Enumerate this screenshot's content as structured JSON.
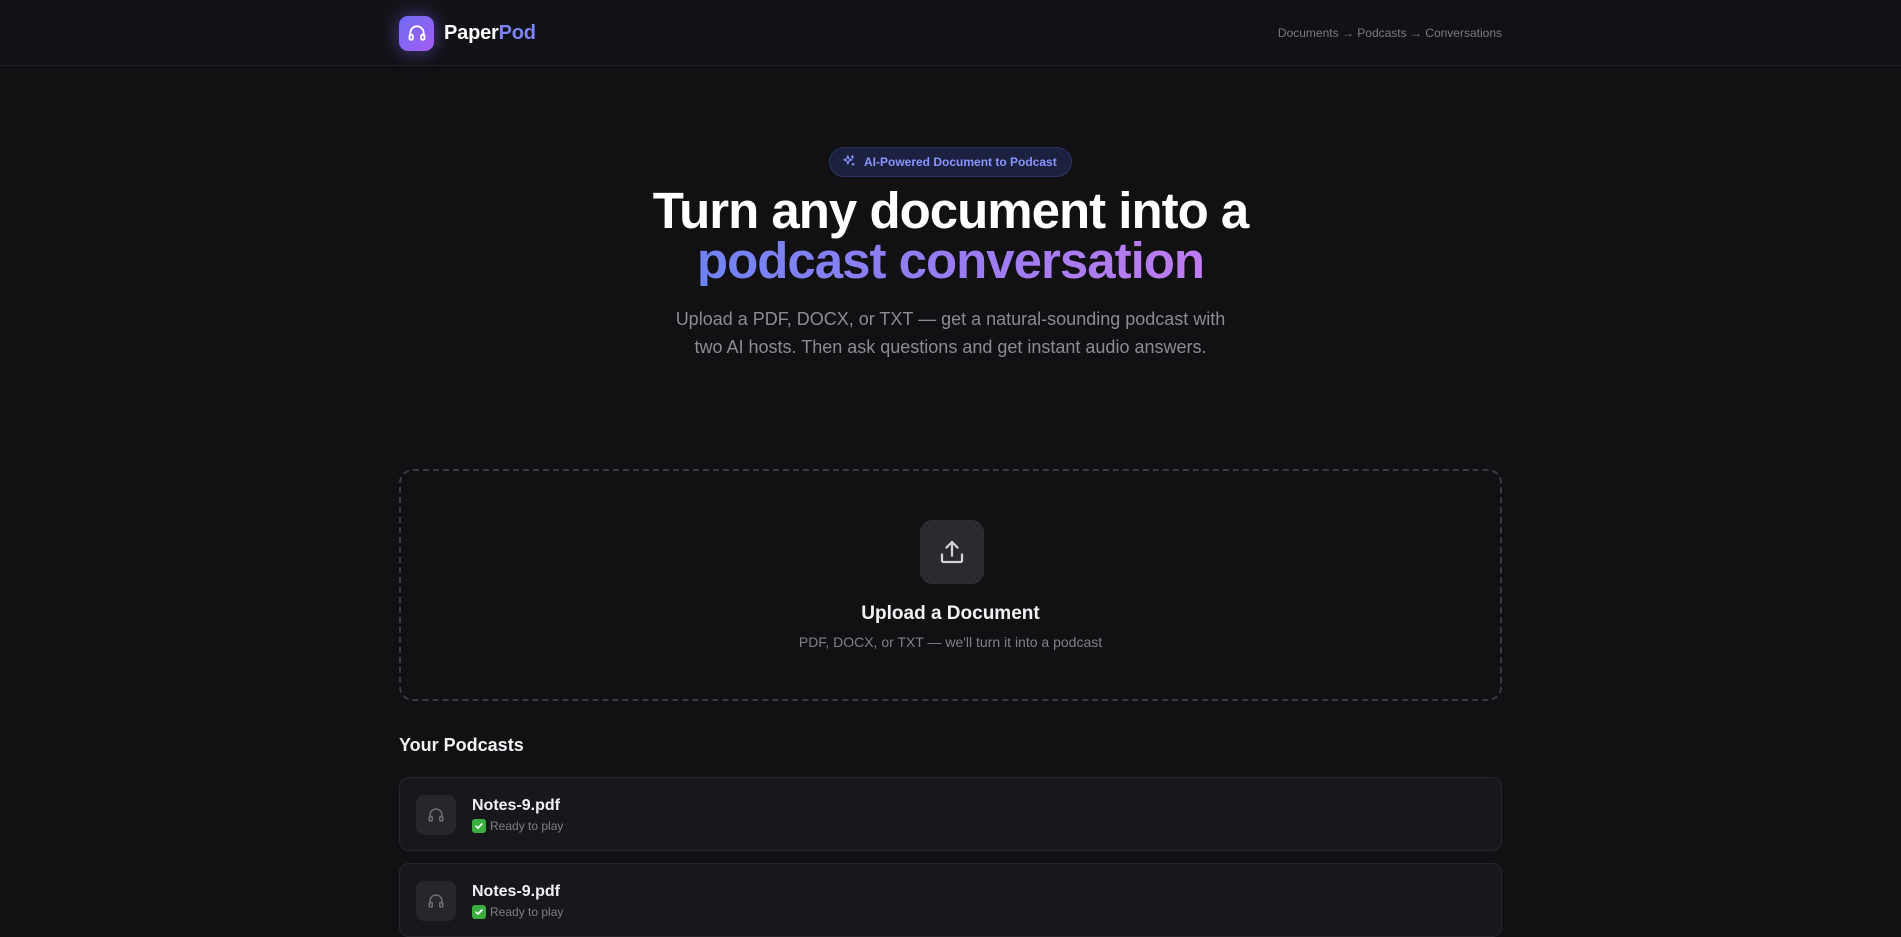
{
  "header": {
    "brand_part1": "Paper",
    "brand_part2": "Pod",
    "logo_icon": "headphones-icon",
    "breadcrumb": "Documents → Podcasts → Conversations"
  },
  "hero": {
    "badge_icon": "sparkles-icon",
    "badge_text": "AI-Powered Document to Podcast",
    "title_line1": "Turn any document into a",
    "title_line2": "podcast conversation",
    "subtitle": "Upload a PDF, DOCX, or TXT — get a natural-sounding podcast with two AI hosts. Then ask questions and get instant audio answers."
  },
  "upload": {
    "icon": "upload-icon",
    "title": "Upload a Document",
    "subtitle": "PDF, DOCX, or TXT — we'll turn it into a podcast"
  },
  "podcasts": {
    "section_title": "Your Podcasts",
    "items": [
      {
        "name": "Notes-9.pdf",
        "status": "Ready to play",
        "status_icon": "check-mark-icon"
      },
      {
        "name": "Notes-9.pdf",
        "status": "Ready to play",
        "status_icon": "check-mark-icon"
      }
    ]
  },
  "colors": {
    "background": "#111114",
    "accent_start": "#6f83f4",
    "accent_end": "#c07bf0",
    "brand_pod": "#7c83f7",
    "ready_green": "#3cae3f"
  }
}
